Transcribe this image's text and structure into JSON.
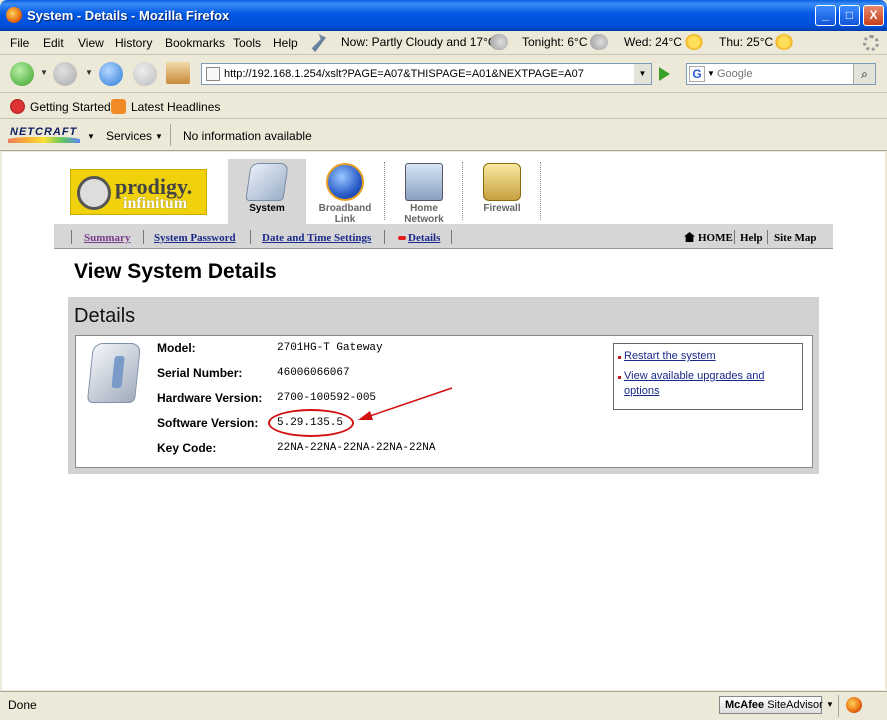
{
  "window": {
    "title": "System - Details - Mozilla Firefox",
    "minimize": "_",
    "maximize": "□",
    "close": "X"
  },
  "menu": [
    "File",
    "Edit",
    "View",
    "History",
    "Bookmarks",
    "Tools",
    "Help"
  ],
  "weather": {
    "now": "Now: Partly Cloudy and 17°C",
    "tonight": "Tonight: 6°C",
    "wed": "Wed: 24°C",
    "thu": "Thu: 25°C"
  },
  "nav": {
    "url": "http://192.168.1.254/xslt?PAGE=A07&THISPAGE=A01&NEXTPAGE=A07",
    "search_placeholder": "Google",
    "search_engine_glyph": "G"
  },
  "bookmarks": [
    "Getting Started",
    "Latest Headlines"
  ],
  "netcraft": {
    "logo_text": "NETCRAFT",
    "services": "Services",
    "info": "No information available"
  },
  "router": {
    "logo": {
      "brand": "prodigy.",
      "sub": "infinitum"
    },
    "tabs": [
      {
        "label": "System",
        "active": true
      },
      {
        "label": "Broadband Link",
        "active": false
      },
      {
        "label": "Home Network",
        "active": false
      },
      {
        "label": "Firewall",
        "active": false
      }
    ],
    "subnav": [
      "Summary",
      "System Password",
      "Date and Time Settings",
      "Details"
    ],
    "subnav_right": [
      "HOME",
      "Help",
      "Site Map"
    ],
    "page_title": "View System Details",
    "panel_title": "Details",
    "details": [
      {
        "label": "Model:",
        "value": "2701HG-T Gateway"
      },
      {
        "label": "Serial Number:",
        "value": "46006066067"
      },
      {
        "label": "Hardware Version:",
        "value": "2700-100592-005"
      },
      {
        "label": "Software Version:",
        "value": "5.29.135.5"
      },
      {
        "label": "Key Code:",
        "value": "22NA-22NA-22NA-22NA-22NA"
      }
    ],
    "actions": [
      "Restart the system",
      "View available upgrades and",
      "options"
    ]
  },
  "status": {
    "text": "Done",
    "mcafee_brand": "McAfee",
    "mcafee_product": "SiteAdvisor"
  },
  "colors": {
    "titlebar": "#0058e6",
    "highlight_red": "#d21010",
    "link": "#1a2a8a",
    "logo_yellow": "#f0d20c"
  }
}
